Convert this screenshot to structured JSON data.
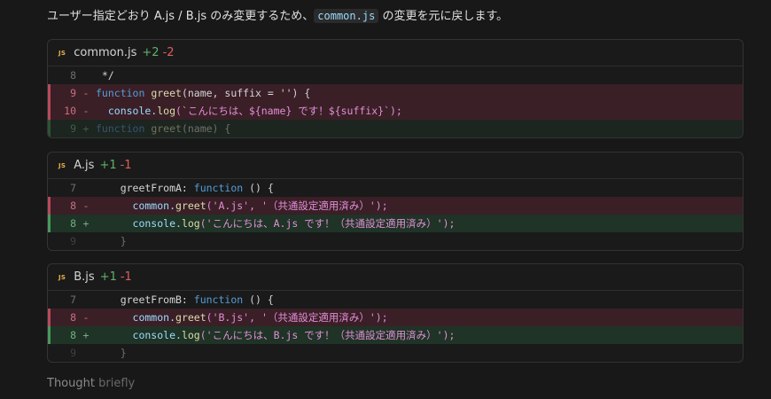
{
  "intro": {
    "prefix": "ユーザー指定どおり A.js / B.js のみ変更するため、",
    "code": "common.js",
    "suffix": " の変更を元に戻します。"
  },
  "diffs": [
    {
      "icon": "JS",
      "file": "common.js",
      "added": "+2",
      "removed": "-2",
      "lines": [
        {
          "num": "8",
          "sign": "",
          "text": " */"
        },
        {
          "num": "9",
          "sign": "-",
          "a": "function ",
          "b": "greet",
          "c": "(name, suffix = '') {"
        },
        {
          "num": "10",
          "sign": "-",
          "a": "  console.",
          "b": "log",
          "c": "(`こんにちは、${name} です！${suffix}`);"
        },
        {
          "num": "9",
          "sign": "+",
          "a": "function ",
          "b": "greet",
          "c": "(name) {"
        }
      ]
    },
    {
      "icon": "JS",
      "file": "A.js",
      "added": "+1",
      "removed": "-1",
      "lines": [
        {
          "num": "7",
          "sign": "",
          "a": "    greetFromA: ",
          "b": "function",
          "c": " () {"
        },
        {
          "num": "8",
          "sign": "-",
          "a": "      common.",
          "b": "greet",
          "c": "('A.js', '（共通設定適用済み）');"
        },
        {
          "num": "8",
          "sign": "+",
          "a": "      console.",
          "b": "log",
          "c": "('こんにちは、A.js です！（共通設定適用済み）');"
        },
        {
          "num": "9",
          "sign": "",
          "text": "    }"
        }
      ]
    },
    {
      "icon": "JS",
      "file": "B.js",
      "added": "+1",
      "removed": "-1",
      "lines": [
        {
          "num": "7",
          "sign": "",
          "a": "    greetFromB: ",
          "b": "function",
          "c": " () {"
        },
        {
          "num": "8",
          "sign": "-",
          "a": "      common.",
          "b": "greet",
          "c": "('B.js', '（共通設定適用済み）');"
        },
        {
          "num": "8",
          "sign": "+",
          "a": "      console.",
          "b": "log",
          "c": "('こんにちは、B.js です！（共通設定適用済み）');"
        },
        {
          "num": "9",
          "sign": "",
          "text": "    }"
        }
      ]
    }
  ],
  "thought": {
    "label": "Thought",
    "detail": "briefly"
  }
}
